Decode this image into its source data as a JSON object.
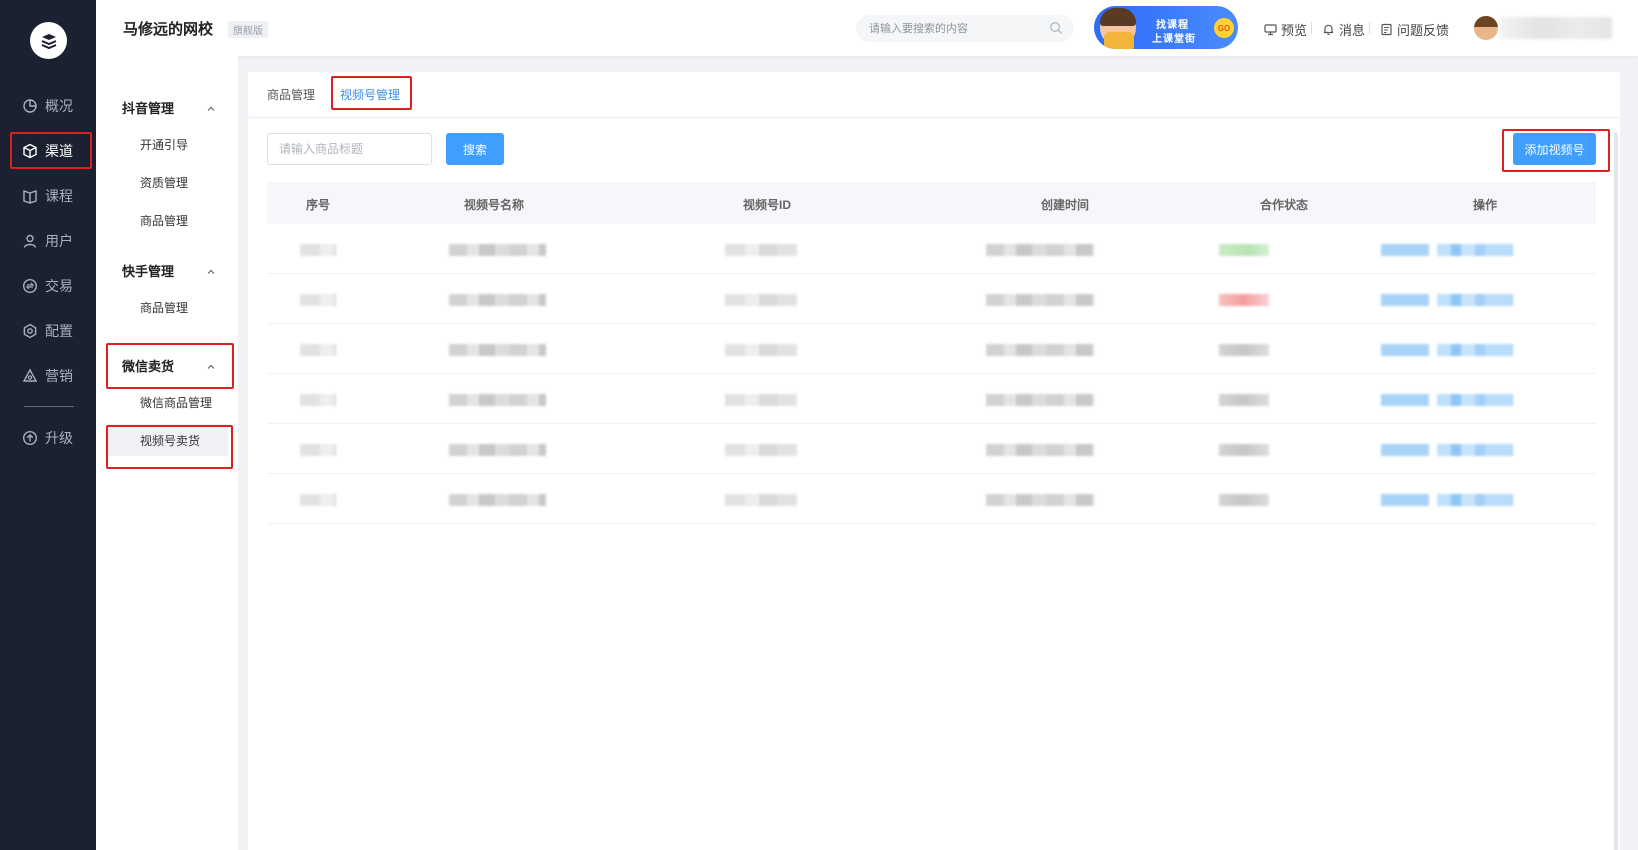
{
  "colors": {
    "sidebar_bg": "#1b2131",
    "accent": "#409eff",
    "annotation_red": "#e02020",
    "status_green": "#b7e3b3",
    "status_red": "#f49c9c"
  },
  "sidebar": {
    "logo_icon": "school-logo-icon",
    "items": [
      {
        "label": "概况",
        "icon": "pie-chart-icon"
      },
      {
        "label": "渠道",
        "icon": "cube-icon",
        "active": true
      },
      {
        "label": "课程",
        "icon": "book-icon"
      },
      {
        "label": "用户",
        "icon": "user-icon"
      },
      {
        "label": "交易",
        "icon": "exchange-icon"
      },
      {
        "label": "配置",
        "icon": "settings-icon"
      },
      {
        "label": "营销",
        "icon": "marketing-icon"
      }
    ],
    "upgrade_label": "升级"
  },
  "header": {
    "school_name": "马修远的网校",
    "edition": "旗舰版",
    "search_placeholder": "请输入要搜索的内容",
    "promo": {
      "line1": "找课程",
      "line2": "上课堂街",
      "go": "GO"
    },
    "links": {
      "preview": "预览",
      "messages": "消息",
      "feedback": "问题反馈"
    }
  },
  "submenu": {
    "groups": [
      {
        "title": "抖音管理",
        "items": [
          "开通引导",
          "资质管理",
          "商品管理"
        ]
      },
      {
        "title": "快手管理",
        "items": [
          "商品管理"
        ]
      },
      {
        "title": "微信卖货",
        "items": [
          "微信商品管理",
          "视频号卖货"
        ]
      }
    ],
    "active_item": "视频号卖货"
  },
  "main": {
    "tabs": [
      {
        "label": "商品管理",
        "active": false
      },
      {
        "label": "视频号管理",
        "active": true
      }
    ],
    "filter": {
      "placeholder": "请输入商品标题",
      "search_label": "搜索"
    },
    "add_button_label": "添加视频号",
    "table": {
      "columns": [
        "序号",
        "视频号名称",
        "视频号ID",
        "创建时间",
        "合作状态",
        "操作"
      ],
      "row_count": 6,
      "rows_status_colors": [
        "green",
        "red",
        "gray",
        "gray",
        "gray",
        "gray"
      ]
    }
  }
}
